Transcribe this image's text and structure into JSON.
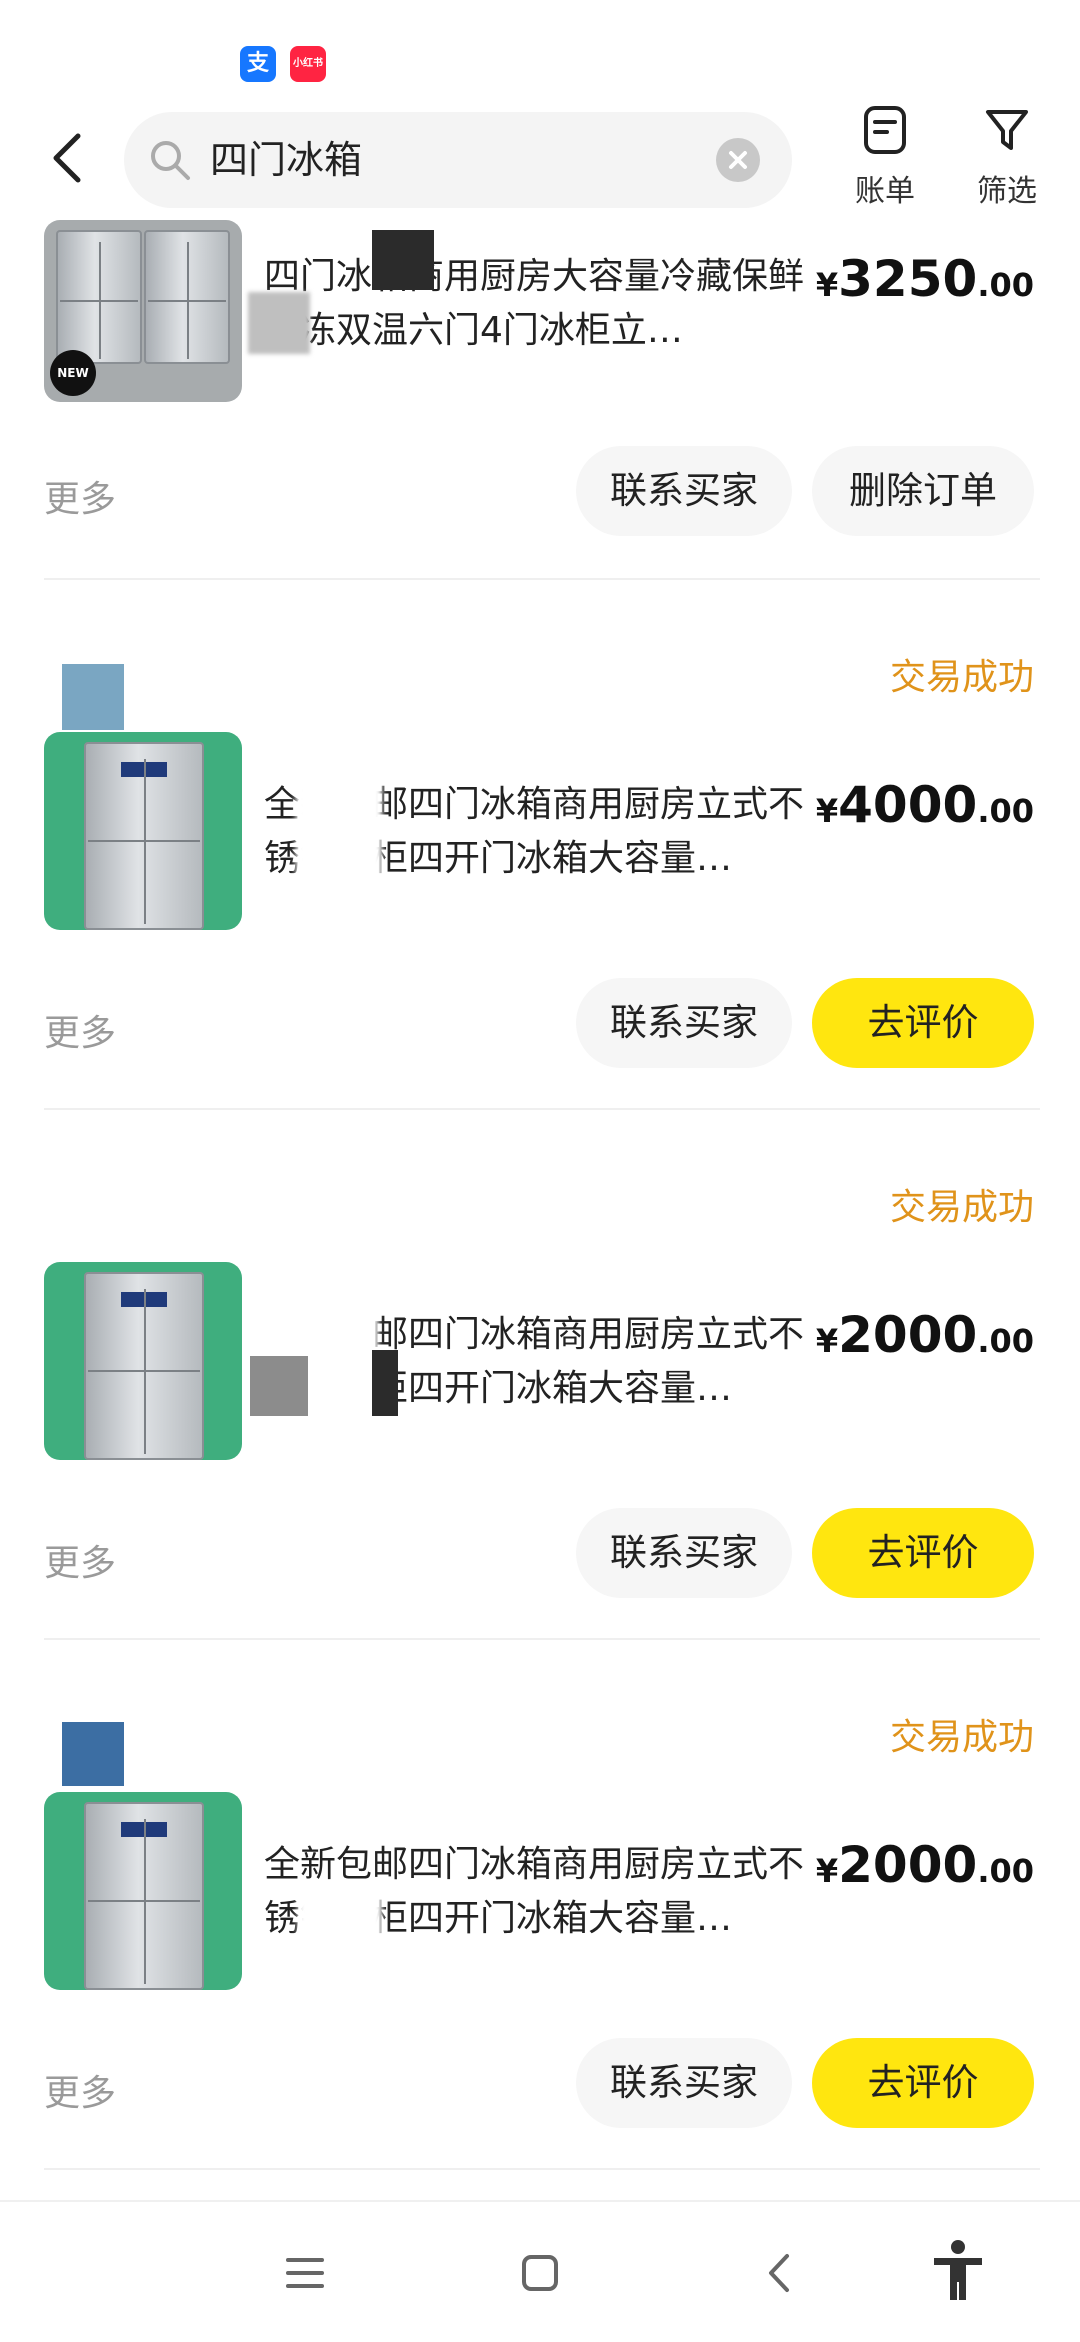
{
  "search": {
    "query": "四门冰箱"
  },
  "header": {
    "bill_label": "账单",
    "filter_label": "筛选"
  },
  "orders": [
    {
      "title": "四门冰箱商用厨房大容量冷藏保鲜冷冻双温六门4门冰柜立…",
      "price_int": "3250",
      "price_dec": ".00",
      "currency": "¥",
      "status": "",
      "more": "更多",
      "contact": "联系买家",
      "action": "删除订单"
    },
    {
      "title": "全新包邮四门冰箱商用厨房立式不锈钢冰柜四开门冰箱大容量…",
      "price_int": "4000",
      "price_dec": ".00",
      "currency": "¥",
      "status": "交易成功",
      "more": "更多",
      "contact": "联系买家",
      "action": "去评价"
    },
    {
      "title": "全新包邮四门冰箱商用厨房立式不锈钢冰柜四开门冰箱大容量…",
      "price_int": "2000",
      "price_dec": ".00",
      "currency": "¥",
      "status": "交易成功",
      "more": "更多",
      "contact": "联系买家",
      "action": "去评价"
    },
    {
      "title": "全新包邮四门冰箱商用厨房立式不锈钢冰柜四开门冰箱大容量…",
      "price_int": "2000",
      "price_dec": ".00",
      "currency": "¥",
      "status": "交易成功",
      "more": "更多",
      "contact": "联系买家",
      "action": "去评价"
    }
  ],
  "colors": {
    "accent_yellow": "#ffe60f",
    "status_orange": "#e0931a"
  },
  "icons": [
    "back-icon",
    "search-icon",
    "clear-icon",
    "bill-icon",
    "filter-icon",
    "menu-icon",
    "home-icon",
    "nav-back-icon",
    "accessibility-icon"
  ]
}
